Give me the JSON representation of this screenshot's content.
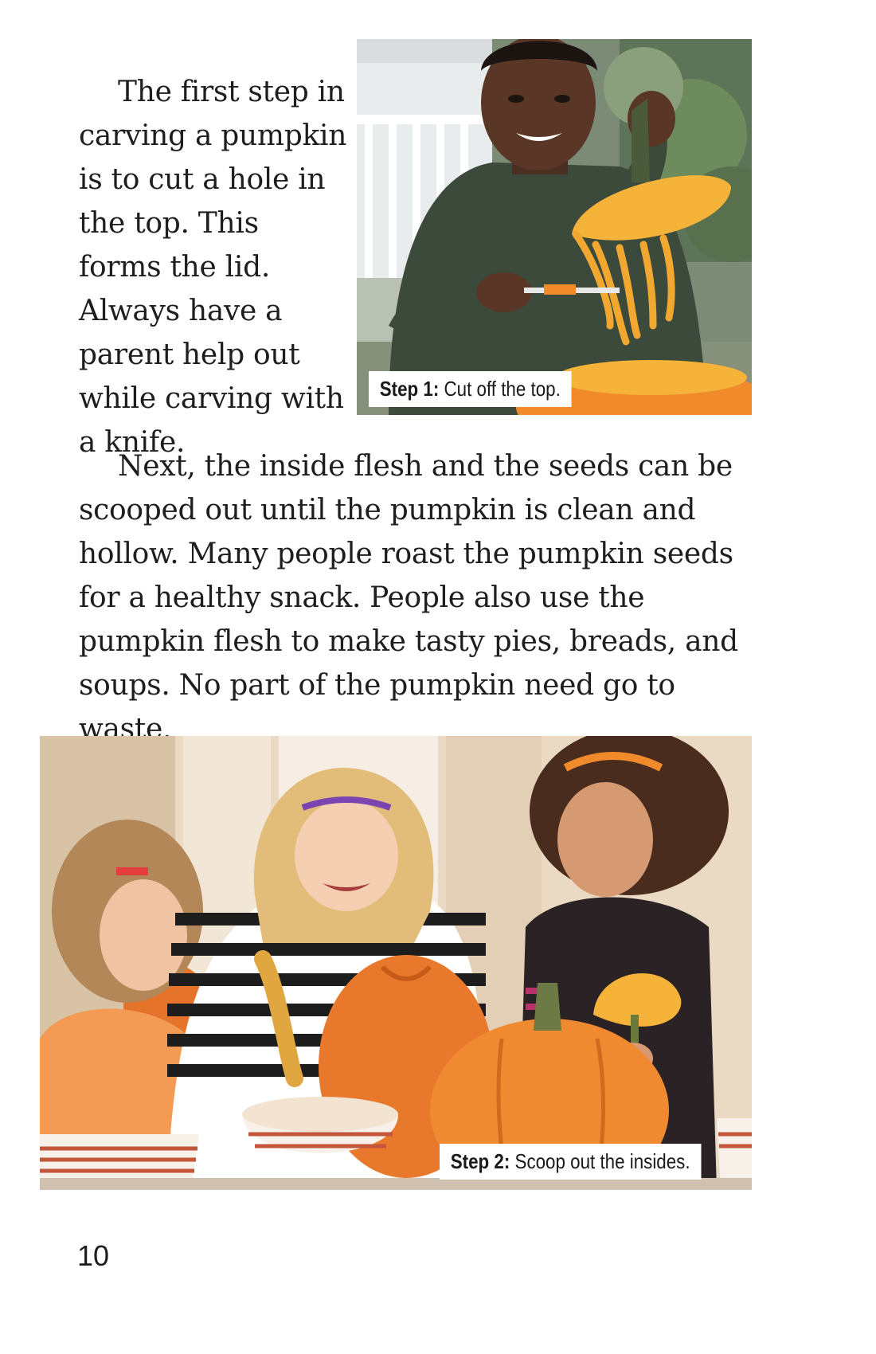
{
  "paragraph1": "The first step in carving a pumpkin is to cut a hole in the top. This forms the lid. Always have a parent help out while carving with a knife.",
  "paragraph2": "Next, the inside flesh and the seeds can be scooped out until the pumpkin is clean and hollow. Many people roast the pumpkin seeds for a healthy snack. People also use the pumpkin flesh to make tasty pies, breads, and soups. No part of the pumpkin need go to waste.",
  "photo1": {
    "caption_label": "Step 1:",
    "caption_text": "Cut off the top."
  },
  "photo2": {
    "caption_label": "Step 2:",
    "caption_text": "Scoop out the insides."
  },
  "page_number": "10",
  "colors": {
    "pumpkin": "#f08a2a",
    "pumpkin_flesh": "#f6b33a",
    "sweater": "#3c4a3c",
    "text": "#1e1e1e"
  }
}
